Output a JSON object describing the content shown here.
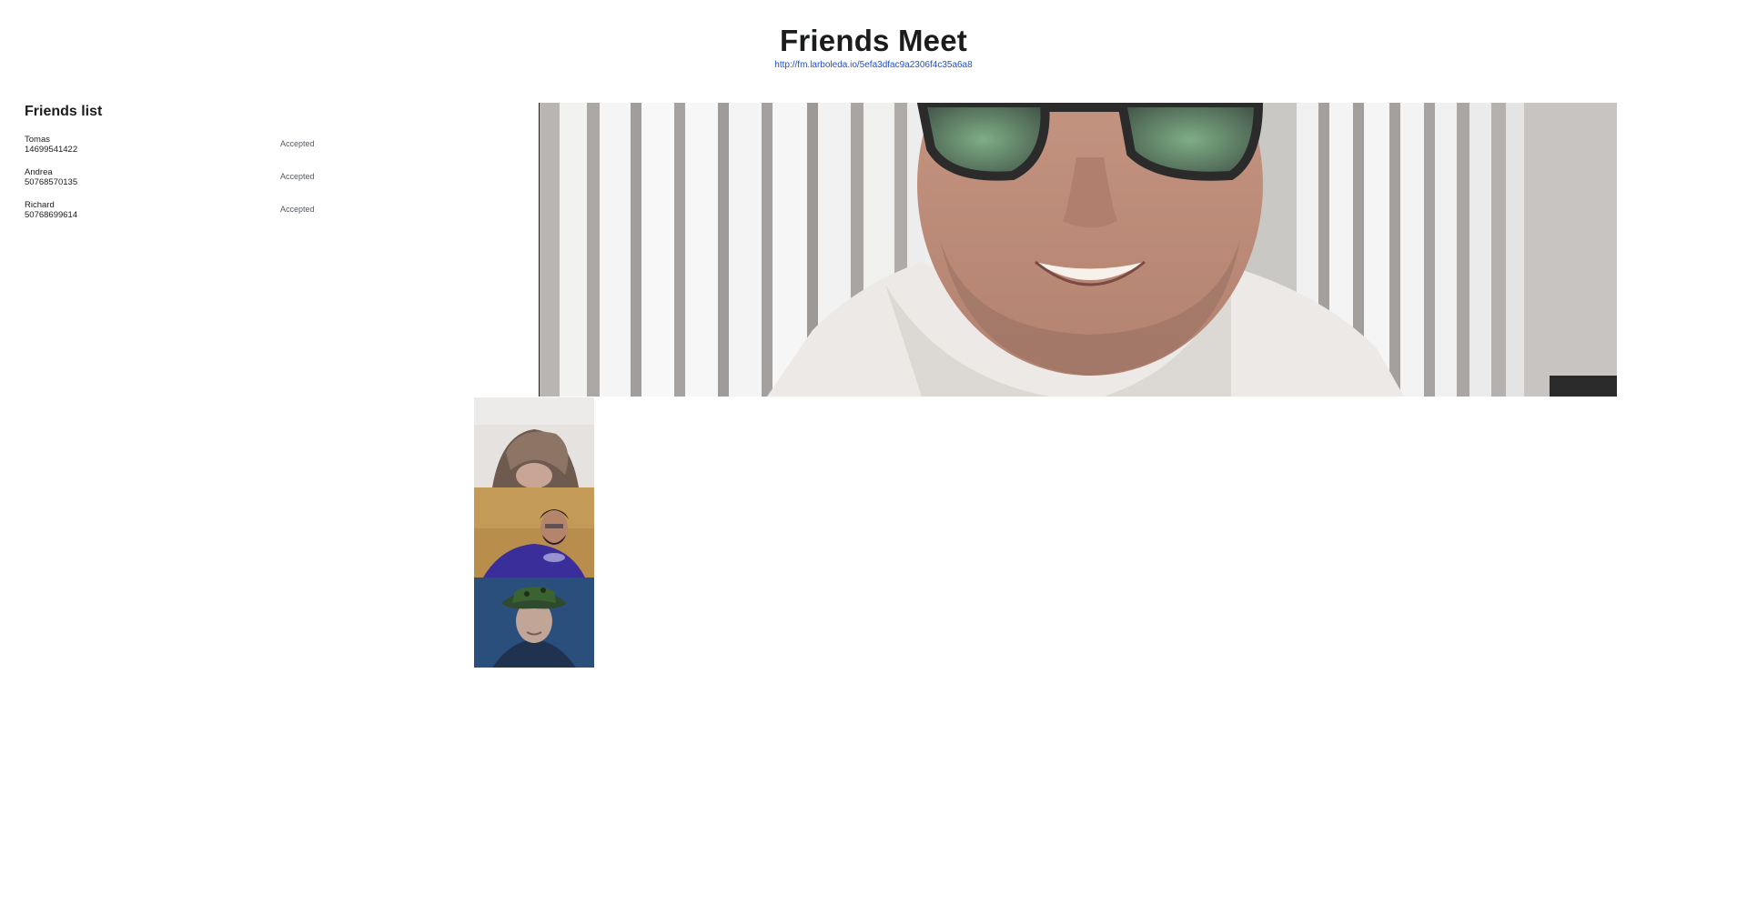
{
  "header": {
    "title": "Friends Meet",
    "room_link": "http://fm.larboleda.io/5efa3dfac9a2306f4c35a6a8"
  },
  "friends": {
    "heading": "Friends list",
    "items": [
      {
        "name": "Tomas",
        "phone": "14699541422",
        "status": "Accepted"
      },
      {
        "name": "Andrea",
        "phone": "50768570135",
        "status": "Accepted"
      },
      {
        "name": "Richard",
        "phone": "50768699614",
        "status": "Accepted"
      }
    ]
  },
  "videos": {
    "main": {
      "icon": "person-video-feed"
    },
    "thumbnails": [
      {
        "icon": "person-video-feed"
      },
      {
        "icon": "person-video-feed"
      },
      {
        "icon": "person-video-feed"
      }
    ]
  },
  "colors": {
    "link": "#1f4fd6",
    "text": "#1b1c1d",
    "status": "#555a60"
  }
}
